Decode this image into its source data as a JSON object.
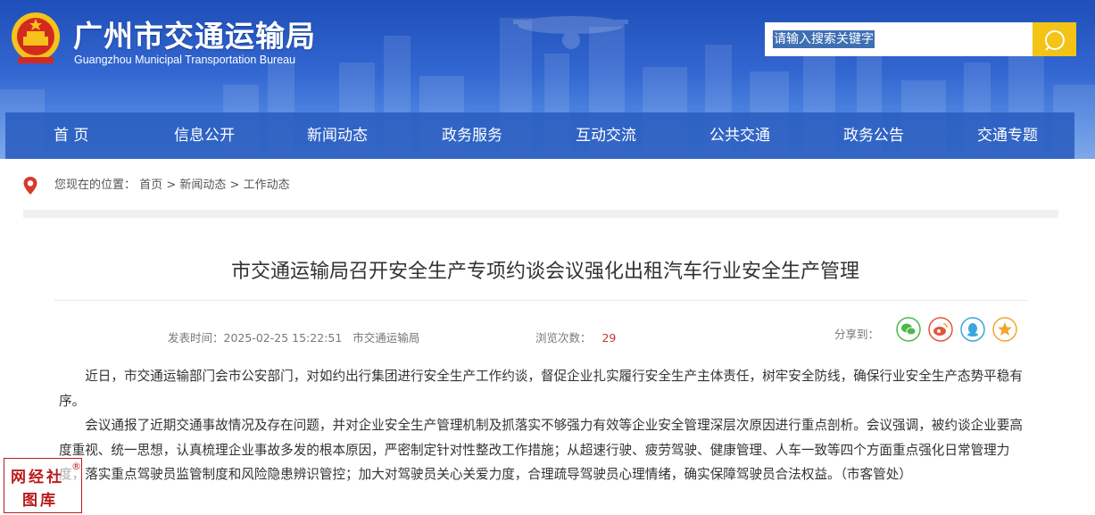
{
  "header": {
    "title": "广州市交通运输局",
    "subtitle": "Guangzhou Municipal Transportation Bureau",
    "emblem_icon": "national-emblem-icon",
    "colors": {
      "banner_top": "#1f4fb9",
      "banner_bottom": "#6f9ee6",
      "search_button": "#f3c316"
    }
  },
  "search": {
    "value": "请输入搜索关键字",
    "button_icon": "search-icon"
  },
  "nav": {
    "items": [
      "首 页",
      "信息公开",
      "新闻动态",
      "政务服务",
      "互动交流",
      "公共交通",
      "政务公告",
      "交通专题"
    ]
  },
  "breadcrumb": {
    "prefix": "您现在的位置：",
    "items": [
      "首页",
      "新闻动态",
      "工作动态"
    ],
    "separator": ">",
    "icon": "location-pin-icon"
  },
  "article": {
    "title": "市交通运输局召开安全生产专项约谈会议强化出租汽车行业安全生产管理",
    "publish_label": "发表时间：",
    "publish_time": "2025-02-25 15:22:51",
    "source": "市交通运输局",
    "views_label": "浏览次数：",
    "views": "29",
    "share_label": "分享到：",
    "share_icons": [
      "wechat-icon",
      "weibo-icon",
      "qq-icon",
      "qzone-icon"
    ],
    "paragraphs": [
      "近日，市交通运输部门会市公安部门，对如约出行集团进行安全生产工作约谈，督促企业扎实履行安全生产主体责任，树牢安全防线，确保行业安全生产态势平稳有序。",
      "会议通报了近期交通事故情况及存在问题，并对企业安全生产管理机制及抓落实不够强力有效等企业安全管理深层次原因进行重点剖析。会议强调，被约谈企业要高度重视、统一思想，认真梳理企业事故多发的根本原因，严密制定针对性整改工作措施；从超速行驶、疲劳驾驶、健康管理、人车一致等四个方面重点强化日常管理力度，落实重点驾驶员监管制度和风险隐患辨识管控；加大对驾驶员关心关爱力度，合理疏导驾驶员心理情绪，确实保障驾驶员合法权益。（市客管处）"
    ]
  },
  "watermark": {
    "line1": "网经社",
    "line2": "图库",
    "mark": "®"
  }
}
